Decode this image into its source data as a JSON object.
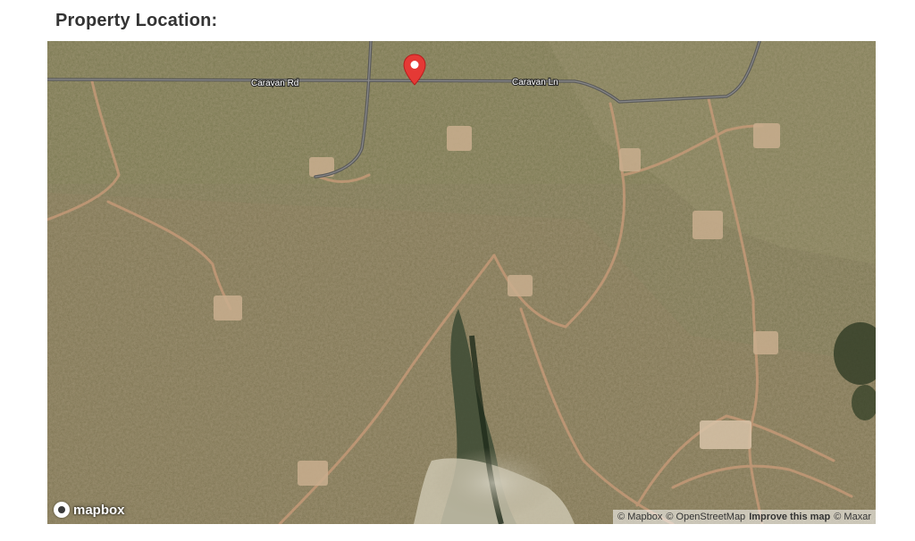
{
  "page": {
    "heading": "Property Location:"
  },
  "map": {
    "road_labels": [
      "Caravan Rd",
      "Caravan Ln"
    ],
    "marker_color": "#e53935",
    "logo_text": "mapbox",
    "attribution": {
      "mapbox": "© Mapbox",
      "osm": "© OpenStreetMap",
      "improve": "Improve this map",
      "maxar": "© Maxar"
    }
  }
}
